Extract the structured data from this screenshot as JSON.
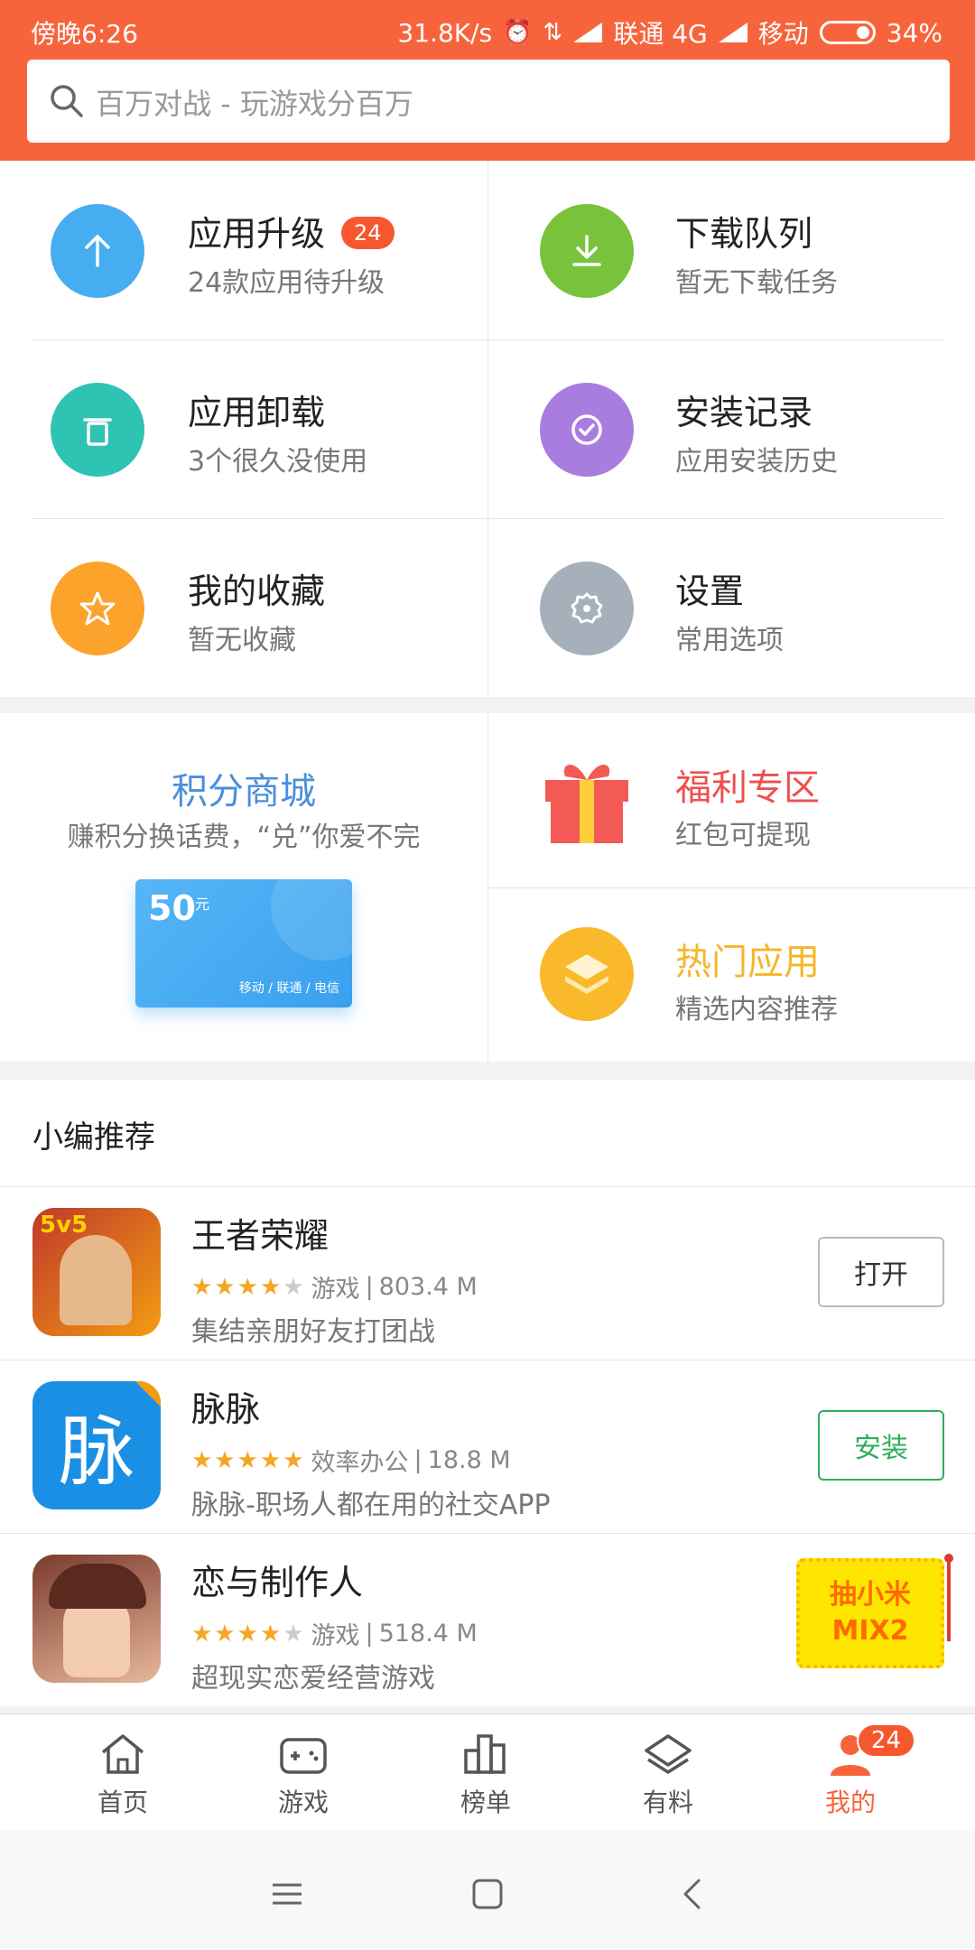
{
  "status_bar": {
    "time": "傍晚6:26",
    "speed": "31.8K/s",
    "carrier1": "联通 4G",
    "carrier2": "移动",
    "battery": "34%"
  },
  "search": {
    "placeholder": "百万对战 - 玩游戏分百万"
  },
  "tools": [
    {
      "title": "应用升级",
      "subtitle": "24款应用待升级",
      "badge": "24",
      "icon": "upload-icon",
      "color": "#46adf0"
    },
    {
      "title": "下载队列",
      "subtitle": "暂无下载任务",
      "icon": "download-icon",
      "color": "#78c23c"
    },
    {
      "title": "应用卸载",
      "subtitle": "3个很久没使用",
      "icon": "trash-icon",
      "color": "#2fc3b4"
    },
    {
      "title": "安装记录",
      "subtitle": "应用安装历史",
      "icon": "check-circle-icon",
      "color": "#a97de0"
    },
    {
      "title": "我的收藏",
      "subtitle": "暂无收藏",
      "icon": "star-icon",
      "color": "#fba32a"
    },
    {
      "title": "设置",
      "subtitle": "常用选项",
      "icon": "gear-icon",
      "color": "#a6b0bb"
    }
  ],
  "promo": {
    "points_title": "积分商城",
    "points_subtitle": "赚积分换话费，“兑”你爱不完",
    "card_amount": "50",
    "card_unit": "元",
    "card_carriers": "移动 / 联通 / 电信",
    "welfare_title": "福利专区",
    "welfare_subtitle": "红包可提现",
    "hot_title": "热门应用",
    "hot_subtitle": "精选内容推荐",
    "welfare_color": "#ef4e4e",
    "hot_color": "#f5b62a"
  },
  "recommend": {
    "title": "小编推荐",
    "apps": [
      {
        "name": "王者荣耀",
        "rating": 3.5,
        "category": "游戏",
        "size": "803.4 M",
        "desc": "集结亲朋好友打团战",
        "button": "打开",
        "icon_text": "5v5"
      },
      {
        "name": "脉脉",
        "rating": 4.5,
        "category": "效率办公",
        "size": "18.8 M",
        "desc": "脉脉-职场人都在用的社交APP",
        "button": "安装",
        "icon_text": "脉"
      },
      {
        "name": "恋与制作人",
        "rating": 3.5,
        "category": "游戏",
        "size": "518.4 M",
        "desc": "超现实恋爱经营游戏",
        "lottery_line1": "抽小米",
        "lottery_line2": "MIX2"
      }
    ]
  },
  "tabbar": {
    "tabs": [
      {
        "label": "首页",
        "icon": "home-icon"
      },
      {
        "label": "游戏",
        "icon": "gamepad-icon"
      },
      {
        "label": "榜单",
        "icon": "chart-icon"
      },
      {
        "label": "有料",
        "icon": "layers-icon"
      },
      {
        "label": "我的",
        "icon": "person-icon"
      }
    ],
    "badge": "24",
    "active_color": "#f7643c"
  }
}
